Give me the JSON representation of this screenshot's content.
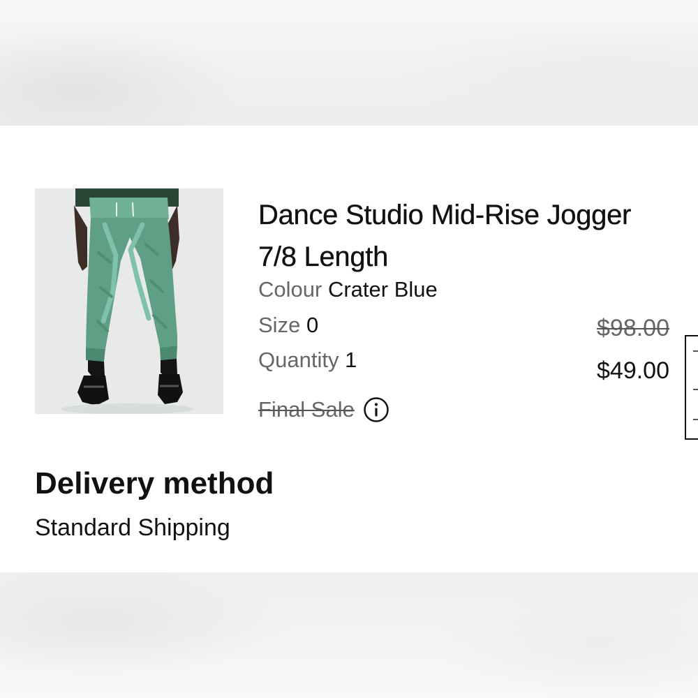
{
  "product": {
    "title": "Dance Studio Mid-Rise Jogger 7/8 Length",
    "image_alt": "green jogger pants",
    "colour": {
      "label": "Colour",
      "value": "Crater Blue"
    },
    "size": {
      "label": "Size",
      "value": "0"
    },
    "quantity": {
      "label": "Quantity",
      "value": "1"
    },
    "final_sale": {
      "label": "Final Sale",
      "icon": "info-icon"
    },
    "price": {
      "original": "$98.00",
      "sale": "$49.00"
    }
  },
  "delivery": {
    "heading": "Delivery method",
    "value": "Standard Shipping"
  },
  "colors": {
    "text": "#111111",
    "muted": "#666666",
    "background": "#ffffff",
    "product": "#5f9f86"
  }
}
